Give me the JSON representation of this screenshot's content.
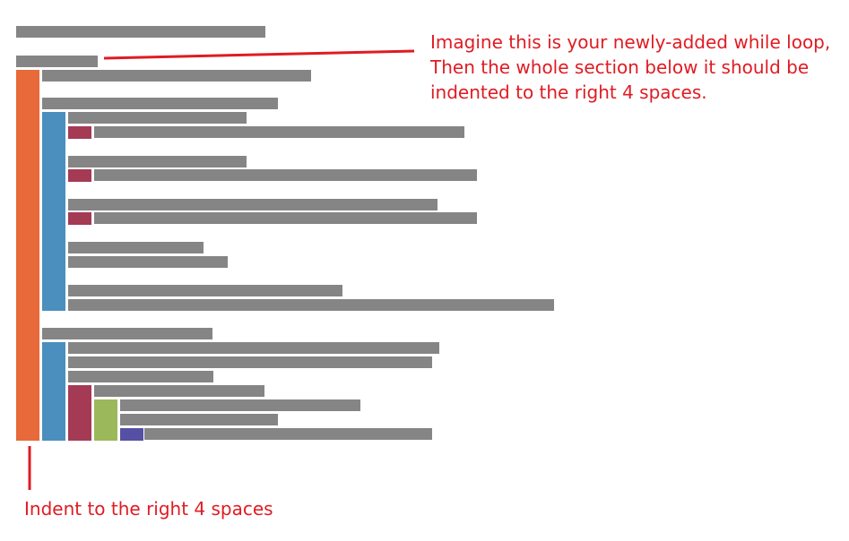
{
  "annotations": {
    "top_note": "Imagine this is your newly-added while loop,\nThen the whole section below it should be\nindented to the right 4 spaces.",
    "bottom_note": "Indent to the right 4 spaces"
  },
  "colors": {
    "code_line": "#858585",
    "indent_level_1": "#E8693A",
    "indent_level_2": "#4A8FBE",
    "indent_level_3": "#A53A55",
    "indent_level_4": "#9BB85B",
    "indent_level_5": "#5550A3",
    "annotation": "#E01B22"
  }
}
